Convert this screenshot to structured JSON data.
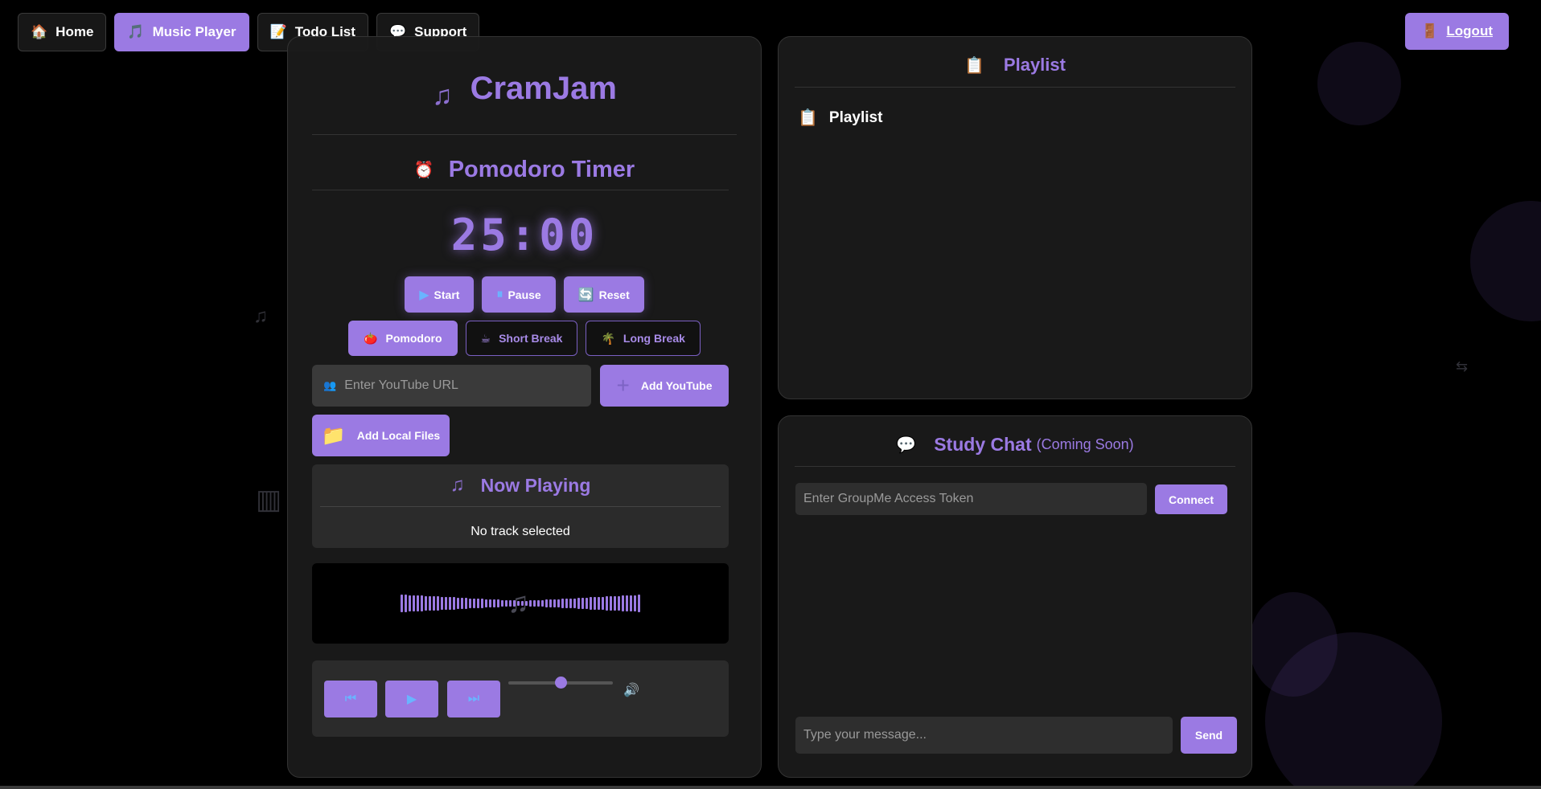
{
  "nav": {
    "items": [
      {
        "icon": "🏠",
        "label": "Home"
      },
      {
        "icon": "🎵",
        "label": "Music Player"
      },
      {
        "icon": "📝",
        "label": "Todo List"
      },
      {
        "icon": "💬",
        "label": "Support"
      }
    ],
    "active": "Music Player",
    "logout": {
      "icon": "🚪",
      "label": "Logout"
    }
  },
  "app": {
    "title": "CramJam",
    "title_icon": "♫"
  },
  "pomodoro": {
    "title": "Pomodoro Timer",
    "title_icon": "⏰",
    "time": "25:00",
    "controls": [
      {
        "icon": "▶",
        "label": "Start"
      },
      {
        "icon": "⏸",
        "label": "Pause"
      },
      {
        "icon": "🔄",
        "label": "Reset"
      }
    ],
    "modes": [
      {
        "icon": "🍅",
        "label": "Pomodoro"
      },
      {
        "icon": "☕",
        "label": "Short Break"
      },
      {
        "icon": "🌴",
        "label": "Long Break"
      }
    ],
    "active_mode": "Pomodoro"
  },
  "youtube": {
    "placeholder": "Enter YouTube URL",
    "input_icon": "👥",
    "add_label": "Add YouTube",
    "add_icon": "+"
  },
  "local": {
    "add_label": "Add Local Files",
    "icon": "📁"
  },
  "now_playing": {
    "title": "Now Playing",
    "icon": "♫",
    "track": "No track selected"
  },
  "visualizer": {
    "icon": "♫"
  },
  "player": {
    "prev_icon": "⏮",
    "play_icon": "▶",
    "next_icon": "⏭",
    "volume": 0.5,
    "volume_icon": "🔊"
  },
  "playlist": {
    "title": "Playlist",
    "icon": "📋",
    "subheading": "Playlist"
  },
  "chat": {
    "title": "Study Chat",
    "subtitle": "(Coming Soon)",
    "icon": "💬",
    "token_placeholder": "Enter GroupMe Access Token",
    "connect_label": "Connect",
    "message_placeholder": "Type your message...",
    "send_label": "Send"
  },
  "colors": {
    "accent": "#9b7ae3",
    "background": "#000000",
    "panel": "#1a1a1a"
  }
}
